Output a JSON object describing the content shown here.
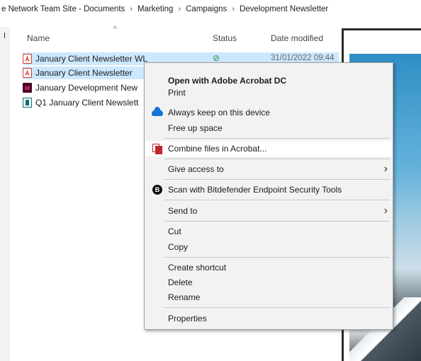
{
  "breadcrumb": {
    "items": [
      "e Network Team Site - Documents",
      "Marketing",
      "Campaigns",
      "Development Newsletter"
    ],
    "separator": "›"
  },
  "columns": {
    "name": "Name",
    "status": "Status",
    "date_modified": "Date modified",
    "sort_caret": "^"
  },
  "files": [
    {
      "name": "January Client Newsletter WL",
      "icon": "pdf-file-icon",
      "status": "⊘",
      "date": "31/01/2022 09:44",
      "selected": true
    },
    {
      "name": "January Client Newsletter",
      "icon": "pdf-file-icon",
      "selected": true
    },
    {
      "name": "January Development New",
      "icon": "indesign-file-icon",
      "selected": false
    },
    {
      "name": "Q1 January Client Newslett",
      "icon": "publisher-file-icon",
      "selected": false
    }
  ],
  "menu": {
    "open_with": "Open with Adobe Acrobat DC",
    "print": "Print",
    "always_keep": "Always keep on this device",
    "free_up": "Free up space",
    "combine": "Combine files in Acrobat...",
    "give_access": "Give access to",
    "scan": "Scan with Bitdefender Endpoint Security Tools",
    "send_to": "Send to",
    "cut": "Cut",
    "copy": "Copy",
    "create_shortcut": "Create shortcut",
    "delete": "Delete",
    "rename": "Rename",
    "properties": "Properties",
    "chevron": "›",
    "bitdefender_glyph": "B"
  },
  "colors": {
    "selection": "#cce8ff",
    "menu_bg": "#f2f2f2",
    "pdf_red": "#d9342b",
    "onedrive_blue": "#1373d9"
  }
}
